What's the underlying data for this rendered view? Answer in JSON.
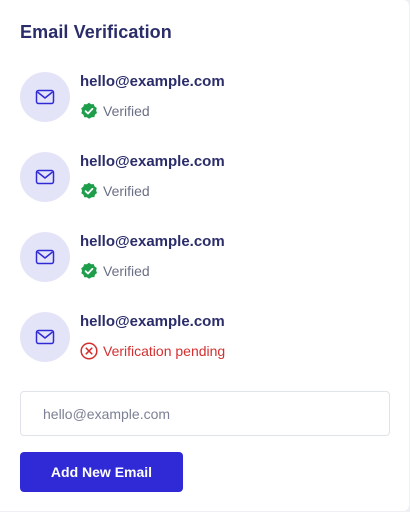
{
  "card": {
    "title": "Email Verification"
  },
  "emails": [
    {
      "address": "hello@example.com",
      "status": "verified",
      "status_text": "Verified",
      "icon": "envelope-icon"
    },
    {
      "address": "hello@example.com",
      "status": "verified",
      "status_text": "Verified",
      "icon": "envelope-icon"
    },
    {
      "address": "hello@example.com",
      "status": "verified",
      "status_text": "Verified",
      "icon": "envelope-icon"
    },
    {
      "address": "hello@example.com",
      "status": "pending",
      "status_text": "Verification pending",
      "icon": "envelope-icon"
    }
  ],
  "new_email": {
    "value": "",
    "placeholder": "hello@example.com"
  },
  "add_button": {
    "label": "Add New Email"
  },
  "colors": {
    "accent": "#2f2ad6",
    "title": "#2b2d6b",
    "verified": "#1e9e4a",
    "pending": "#d32f2f",
    "avatar_bg": "#e4e4f8"
  }
}
